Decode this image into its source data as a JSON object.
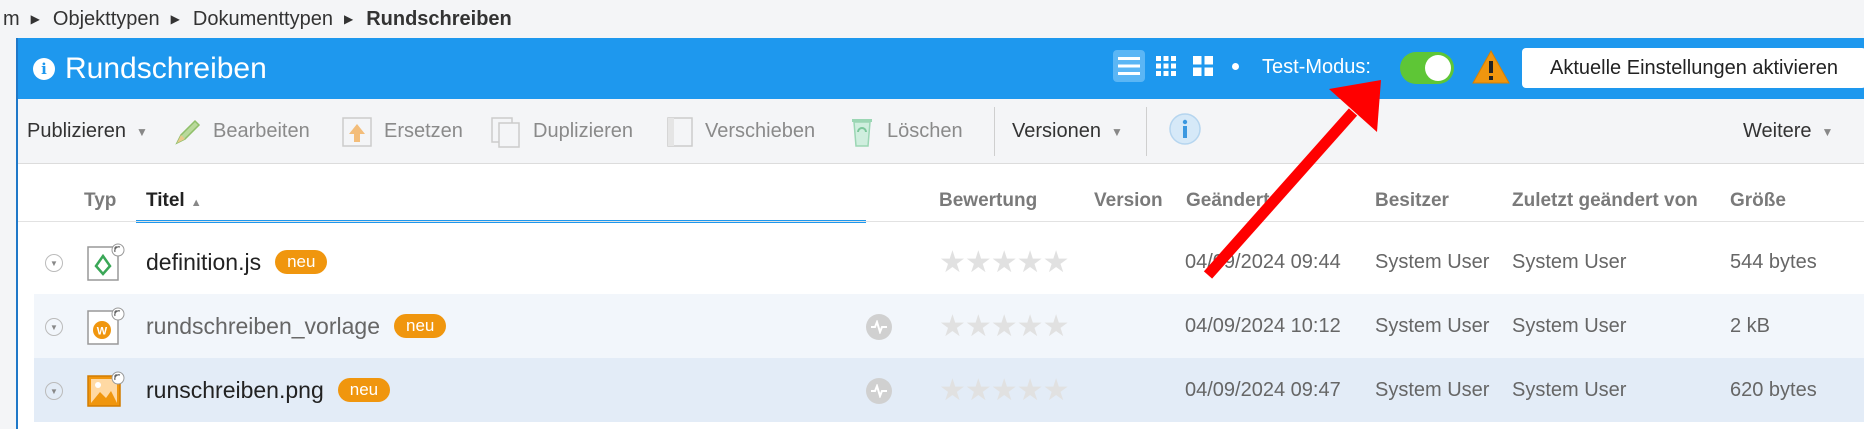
{
  "breadcrumb": {
    "items": [
      "m",
      "Objekttypen",
      "Dokumenttypen"
    ],
    "current": "Rundschreiben"
  },
  "header": {
    "title": "Rundschreiben",
    "test_mode_label": "Test-Modus:",
    "test_mode_on": true,
    "activate_button": "Aktuelle Einstellungen aktivieren",
    "colors": {
      "header_bg": "#1e98ee",
      "toggle_on": "#5ec636",
      "warning": "#f0960e"
    }
  },
  "toolbar": {
    "publish": "Publizieren",
    "edit": "Bearbeiten",
    "replace": "Ersetzen",
    "duplicate": "Duplizieren",
    "move": "Verschieben",
    "delete": "Löschen",
    "versions": "Versionen",
    "more": "Weitere"
  },
  "table": {
    "columns": {
      "type": "Typ",
      "title": "Titel",
      "rating": "Bewertung",
      "version": "Version",
      "modified": "Geändert",
      "owner": "Besitzer",
      "modified_by": "Zuletzt geändert von",
      "size": "Größe"
    },
    "rows": [
      {
        "name": "definition.js",
        "badge": "neu",
        "icon": "js-file-icon",
        "modified": "04/09/2024 09:44",
        "owner": "System User",
        "modified_by": "System User",
        "size": "544 bytes"
      },
      {
        "name": "rundschreiben_vorlage",
        "badge": "neu",
        "icon": "word-template-icon",
        "modified": "04/09/2024 10:12",
        "owner": "System User",
        "modified_by": "System User",
        "size": "2 kB"
      },
      {
        "name": "runschreiben.png",
        "badge": "neu",
        "icon": "image-file-icon",
        "modified": "04/09/2024 09:47",
        "owner": "System User",
        "modified_by": "System User",
        "size": "620 bytes"
      }
    ],
    "stars": "★★★★★"
  }
}
